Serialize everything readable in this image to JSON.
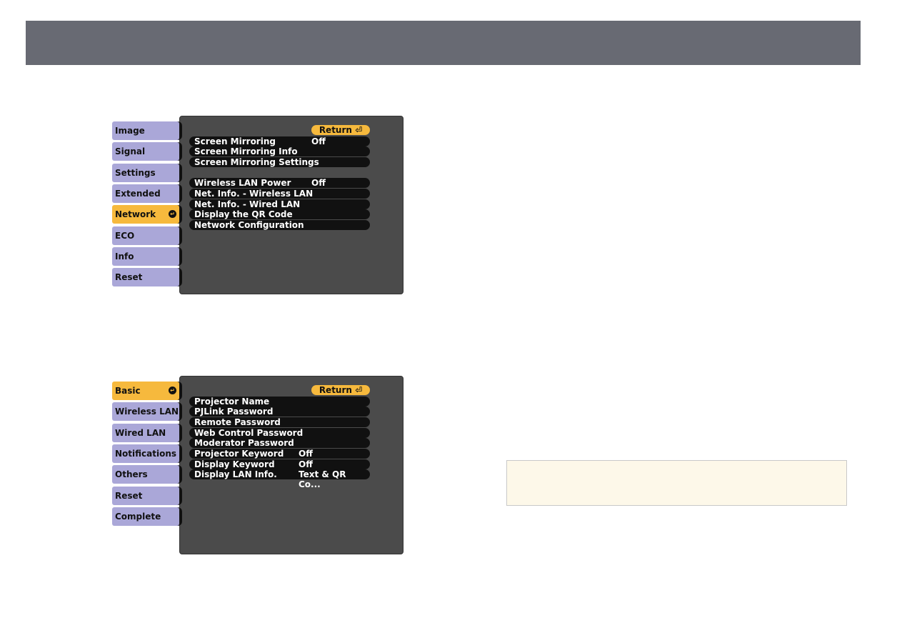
{
  "colors": {
    "header": "#686a73",
    "tab": "#aaa7d8",
    "tab_selected": "#f6b93d",
    "panel": "#4b4b4b",
    "note_bg": "#fdf8e9"
  },
  "menu1": {
    "return_label": "Return",
    "tabs": [
      {
        "label": "Image"
      },
      {
        "label": "Signal"
      },
      {
        "label": "Settings"
      },
      {
        "label": "Extended"
      },
      {
        "label": "Network",
        "selected": true
      },
      {
        "label": "ECO"
      },
      {
        "label": "Info"
      },
      {
        "label": "Reset"
      }
    ],
    "rows": [
      {
        "label": "Screen Mirroring",
        "value": "Off"
      },
      {
        "label": "Screen Mirroring Info",
        "value": ""
      },
      {
        "label": "Screen Mirroring Settings",
        "value": ""
      },
      {
        "gap": true
      },
      {
        "label": "Wireless LAN Power",
        "value": "Off"
      },
      {
        "label": "Net. Info. - Wireless LAN",
        "value": ""
      },
      {
        "label": "Net. Info. - Wired LAN",
        "value": ""
      },
      {
        "label": "Display the QR Code",
        "value": ""
      },
      {
        "label": "Network Configuration",
        "value": ""
      }
    ]
  },
  "menu2": {
    "return_label": "Return",
    "tabs": [
      {
        "label": "Basic",
        "selected": true
      },
      {
        "label": "Wireless LAN"
      },
      {
        "label": "Wired LAN"
      },
      {
        "label": "Notifications"
      },
      {
        "label": "Others"
      },
      {
        "label": "Reset"
      },
      {
        "label": "Complete"
      }
    ],
    "rows": [
      {
        "label": "Projector Name",
        "value": ""
      },
      {
        "label": "PJLink Password",
        "value": ""
      },
      {
        "label": "Remote Password",
        "value": ""
      },
      {
        "label": "Web Control Password",
        "value": ""
      },
      {
        "label": "Moderator Password",
        "value": ""
      },
      {
        "label": "Projector Keyword",
        "value": "Off"
      },
      {
        "label": "Display Keyword",
        "value": "Off"
      },
      {
        "label": "Display LAN Info.",
        "value": "Text & QR Co..."
      }
    ]
  }
}
